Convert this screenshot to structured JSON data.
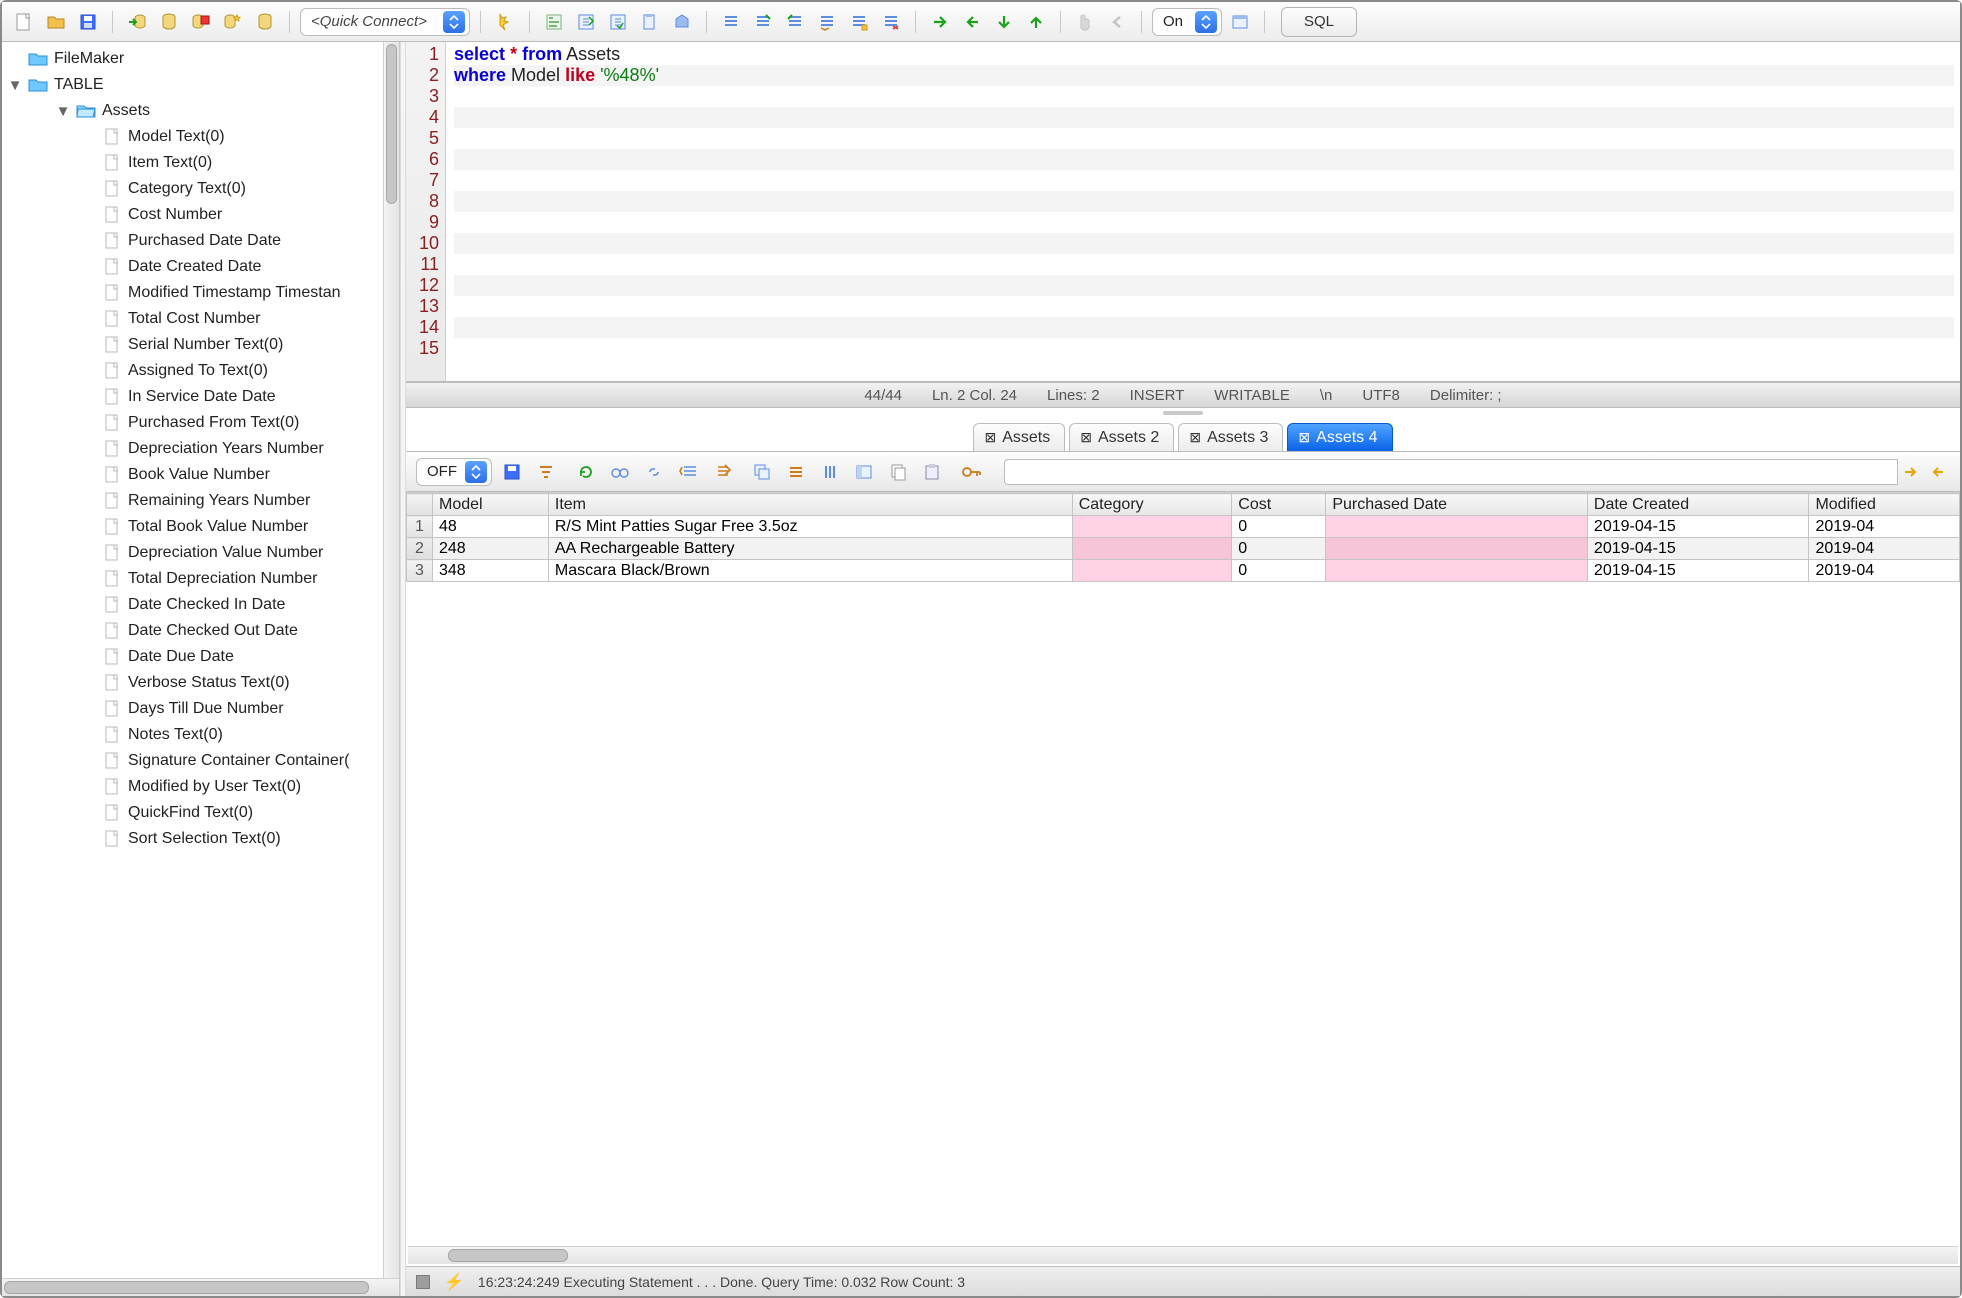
{
  "toolbar": {
    "quick_connect": "<Quick Connect>",
    "on_select": "On",
    "sql_label": "SQL"
  },
  "tree": {
    "db": "FileMaker",
    "schema": "TABLE",
    "table": "Assets",
    "columns": [
      "Model Text(0)",
      "Item Text(0)",
      "Category Text(0)",
      "Cost Number",
      "Purchased Date Date",
      "Date Created Date",
      "Modified Timestamp Timestan",
      "Total Cost Number",
      "Serial Number Text(0)",
      "Assigned To Text(0)",
      "In Service Date Date",
      "Purchased From Text(0)",
      "Depreciation Years Number",
      "Book Value Number",
      "Remaining Years Number",
      "Total Book Value Number",
      "Depreciation Value Number",
      "Total Depreciation Number",
      "Date Checked In Date",
      "Date Checked Out Date",
      "Date Due Date",
      "Verbose Status Text(0)",
      "Days Till Due Number",
      "Notes Text(0)",
      "Signature Container Container(",
      "Modified by User Text(0)",
      "QuickFind Text(0)",
      "Sort Selection Text(0)"
    ]
  },
  "editor": {
    "visible_line_count": 15,
    "line1_tokens": {
      "select": "select",
      "star": "*",
      "from": "from",
      "assets": "Assets"
    },
    "line2_tokens": {
      "where": "where",
      "model": "Model",
      "like": "like",
      "lit": "'%48%'"
    }
  },
  "editor_status": {
    "pos_chars": "44/44",
    "ln_col": "Ln. 2 Col. 24",
    "lines": "Lines: 2",
    "insert": "INSERT",
    "writable": "WRITABLE",
    "newline": "\\n",
    "enc": "UTF8",
    "delim": "Delimiter: ;"
  },
  "tabs": [
    "Assets",
    "Assets 2",
    "Assets 3",
    "Assets 4"
  ],
  "active_tab_index": 3,
  "result_toolbar": {
    "off_label": "OFF"
  },
  "grid": {
    "headers": [
      "Model",
      "Item",
      "Category",
      "Cost",
      "Purchased Date",
      "Date Created",
      "Modified"
    ],
    "pink_cols": [
      2,
      4
    ],
    "rows": [
      {
        "n": "1",
        "cells": [
          "48",
          "R/S Mint Patties Sugar Free 3.5oz",
          "",
          "0",
          "",
          "2019-04-15",
          "2019-04"
        ]
      },
      {
        "n": "2",
        "cells": [
          "248",
          "AA Rechargeable Battery",
          "",
          "0",
          "",
          "2019-04-15",
          "2019-04"
        ]
      },
      {
        "n": "3",
        "cells": [
          "348",
          "Mascara Black/Brown",
          "",
          "0",
          "",
          "2019-04-15",
          "2019-04"
        ]
      }
    ]
  },
  "footer": {
    "msg": "16:23:24:249 Executing Statement . . . Done. Query Time: 0.032   Row Count: 3"
  }
}
